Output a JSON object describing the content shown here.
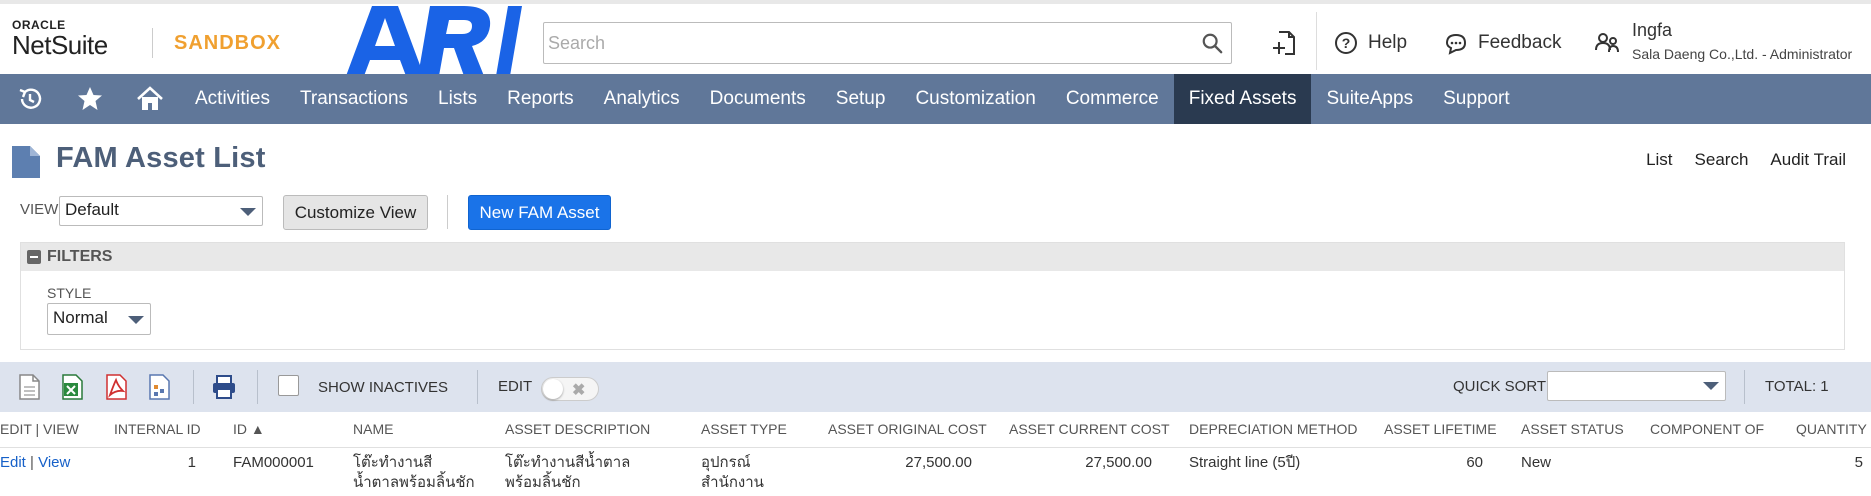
{
  "brand": {
    "oracle": "ORACLE",
    "netsuite": "NetSuite",
    "env": "SANDBOX",
    "logo_text": "ARI"
  },
  "search": {
    "placeholder": "Search"
  },
  "header": {
    "help": "Help",
    "feedback": "Feedback",
    "user_name": "Ingfa",
    "user_role": "Sala Daeng Co.,Ltd. - Administrator"
  },
  "nav": {
    "items": [
      "Activities",
      "Transactions",
      "Lists",
      "Reports",
      "Analytics",
      "Documents",
      "Setup",
      "Customization",
      "Commerce",
      "Fixed Assets",
      "SuiteApps",
      "Support"
    ],
    "active": "Fixed Assets"
  },
  "page": {
    "title": "FAM Asset List",
    "links": {
      "list": "List",
      "search": "Search",
      "audit": "Audit Trail"
    },
    "view_label": "VIEW",
    "view_value": "Default",
    "customize_view": "Customize View",
    "new_button": "New FAM Asset"
  },
  "filters": {
    "title": "FILTERS",
    "style_label": "STYLE",
    "style_value": "Normal"
  },
  "toolbar": {
    "show_inactives": "SHOW INACTIVES",
    "edit_label": "EDIT",
    "quick_sort": "QUICK SORT",
    "quick_sort_value": "",
    "total": "TOTAL: 1"
  },
  "table": {
    "headers": {
      "edit_view": "EDIT | VIEW",
      "internal_id": "INTERNAL ID",
      "id": "ID ▲",
      "name": "NAME",
      "asset_description": "ASSET DESCRIPTION",
      "asset_type": "ASSET TYPE",
      "original_cost": "ASSET ORIGINAL COST",
      "current_cost": "ASSET CURRENT COST",
      "depreciation_method": "DEPRECIATION METHOD",
      "asset_lifetime": "ASSET LIFETIME",
      "asset_status": "ASSET STATUS",
      "component_of": "COMPONENT OF",
      "quantity": "QUANTITY"
    },
    "rows": [
      {
        "edit": "Edit",
        "sep": "|",
        "view": "View",
        "internal_id": "1",
        "id": "FAM000001",
        "name": "โต๊ะทำงานสีน้ำตาลพร้อมลิ้นชัก",
        "asset_description": "โต๊ะทำงานสีน้ำตาลพร้อมลิ้นชัก",
        "asset_type": "อุปกรณ์สำนักงาน",
        "original_cost": "27,500.00",
        "current_cost": "27,500.00",
        "depreciation_method": "Straight line (5ปี)",
        "asset_lifetime": "60",
        "asset_status": "New",
        "component_of": "",
        "quantity": "5"
      }
    ]
  },
  "colors": {
    "nav_bg": "#607799",
    "nav_active": "#2a3a50",
    "primary_button": "#1a73e8",
    "sandbox": "#f0a030",
    "logo": "#1a63e6",
    "link": "#1660c8"
  }
}
